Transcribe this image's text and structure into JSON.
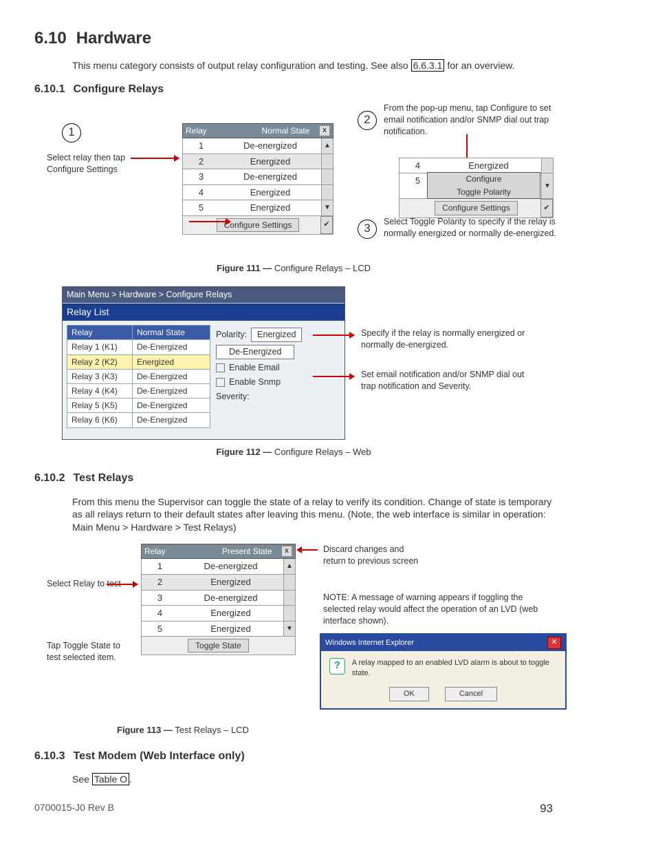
{
  "section": {
    "num": "6.10",
    "title": "Hardware"
  },
  "intro": {
    "text_a": "This menu category consists of output relay configuration and testing. See also ",
    "xref": "6.6.3.1",
    "text_b": " for an overview."
  },
  "sub1": {
    "num": "6.10.1",
    "title": "Configure Relays"
  },
  "fig1": {
    "step1": "Select relay then tap Configure Settings",
    "step2": "From the pop-up menu, tap Configure to set email notification and/or SNMP dial out trap notification.",
    "step3": "Select Toggle Polarity to specify if the relay is normally energized or normally de-energized.",
    "panelA": {
      "h1": "Relay",
      "h2": "Normal State",
      "rows": [
        {
          "r": "1",
          "s": "De-energized"
        },
        {
          "r": "2",
          "s": "Energized"
        },
        {
          "r": "3",
          "s": "De-energized"
        },
        {
          "r": "4",
          "s": "Energized"
        },
        {
          "r": "5",
          "s": "Energized"
        }
      ],
      "btn": "Configure Settings"
    },
    "panelB": {
      "rows": [
        {
          "r": "4",
          "s": "Energized"
        },
        {
          "r": "5",
          "s": ""
        }
      ],
      "menu": [
        "Configure",
        "Toggle Polarity"
      ],
      "btn": "Configure Settings"
    },
    "caption_b": "Figure 111  —",
    "caption_t": "  Configure Relays – LCD"
  },
  "fig2": {
    "breadcrumb": "Main Menu > Hardware > Configure Relays",
    "subtitle": "Relay List",
    "th1": "Relay",
    "th2": "Normal State",
    "rows": [
      {
        "n": "Relay 1 (K1)",
        "s": "De-Energized"
      },
      {
        "n": "Relay 2 (K2)",
        "s": "Energized"
      },
      {
        "n": "Relay 3 (K3)",
        "s": "De-Energized"
      },
      {
        "n": "Relay 4 (K4)",
        "s": "De-Energized"
      },
      {
        "n": "Relay 5 (K5)",
        "s": "De-Energized"
      },
      {
        "n": "Relay 6 (K6)",
        "s": "De-Energized"
      }
    ],
    "opts": {
      "polarity_label": "Polarity:",
      "polarity_val": "Energized",
      "de_val": "De-Energized",
      "email": "Enable Email",
      "snmp": "Enable Snmp",
      "severity": "Severity:"
    },
    "noteA": "Specify if the relay is normally energized or normally de-energized.",
    "noteB": "Set email notification and/or SNMP dial out trap notification and Severity.",
    "caption_b": "Figure 112  —",
    "caption_t": "  Configure Relays – Web"
  },
  "sub2": {
    "num": "6.10.2",
    "title": "Test Relays"
  },
  "sub2_body": "From this menu the Supervisor can toggle the state of a relay to verify its condition. Change of state is temporary as all relays return to their default states after leaving this menu. (Note, the web interface is similar in operation: Main Menu > Hardware > Test Relays)",
  "fig3": {
    "panel": {
      "h1": "Relay",
      "h2": "Present State",
      "rows": [
        {
          "r": "1",
          "s": "De-energized"
        },
        {
          "r": "2",
          "s": "Energized"
        },
        {
          "r": "3",
          "s": "De-energized"
        },
        {
          "r": "4",
          "s": "Energized"
        },
        {
          "r": "5",
          "s": "Energized"
        }
      ],
      "btn": "Toggle State"
    },
    "labA": "Select Relay to test",
    "labB": "Tap Toggle State to test selected item.",
    "labC": "Discard changes and return to previous screen",
    "note": "NOTE: A message of warning appears if toggling the selected relay would affect the operation of an LVD (web interface shown).",
    "ie_title": "Windows Internet Explorer",
    "ie_msg": "A relay mapped to an enabled LVD alarm is about to toggle state.",
    "ok": "OK",
    "cancel": "Cancel",
    "caption_b": "Figure 113  —",
    "caption_t": "  Test Relays – LCD"
  },
  "sub3": {
    "num": "6.10.3",
    "title": "Test Modem (Web Interface only)",
    "see": "See ",
    "xref": "Table O",
    "dot": "."
  },
  "footer": {
    "left": "0700015-J0    Rev B",
    "right": "93"
  }
}
